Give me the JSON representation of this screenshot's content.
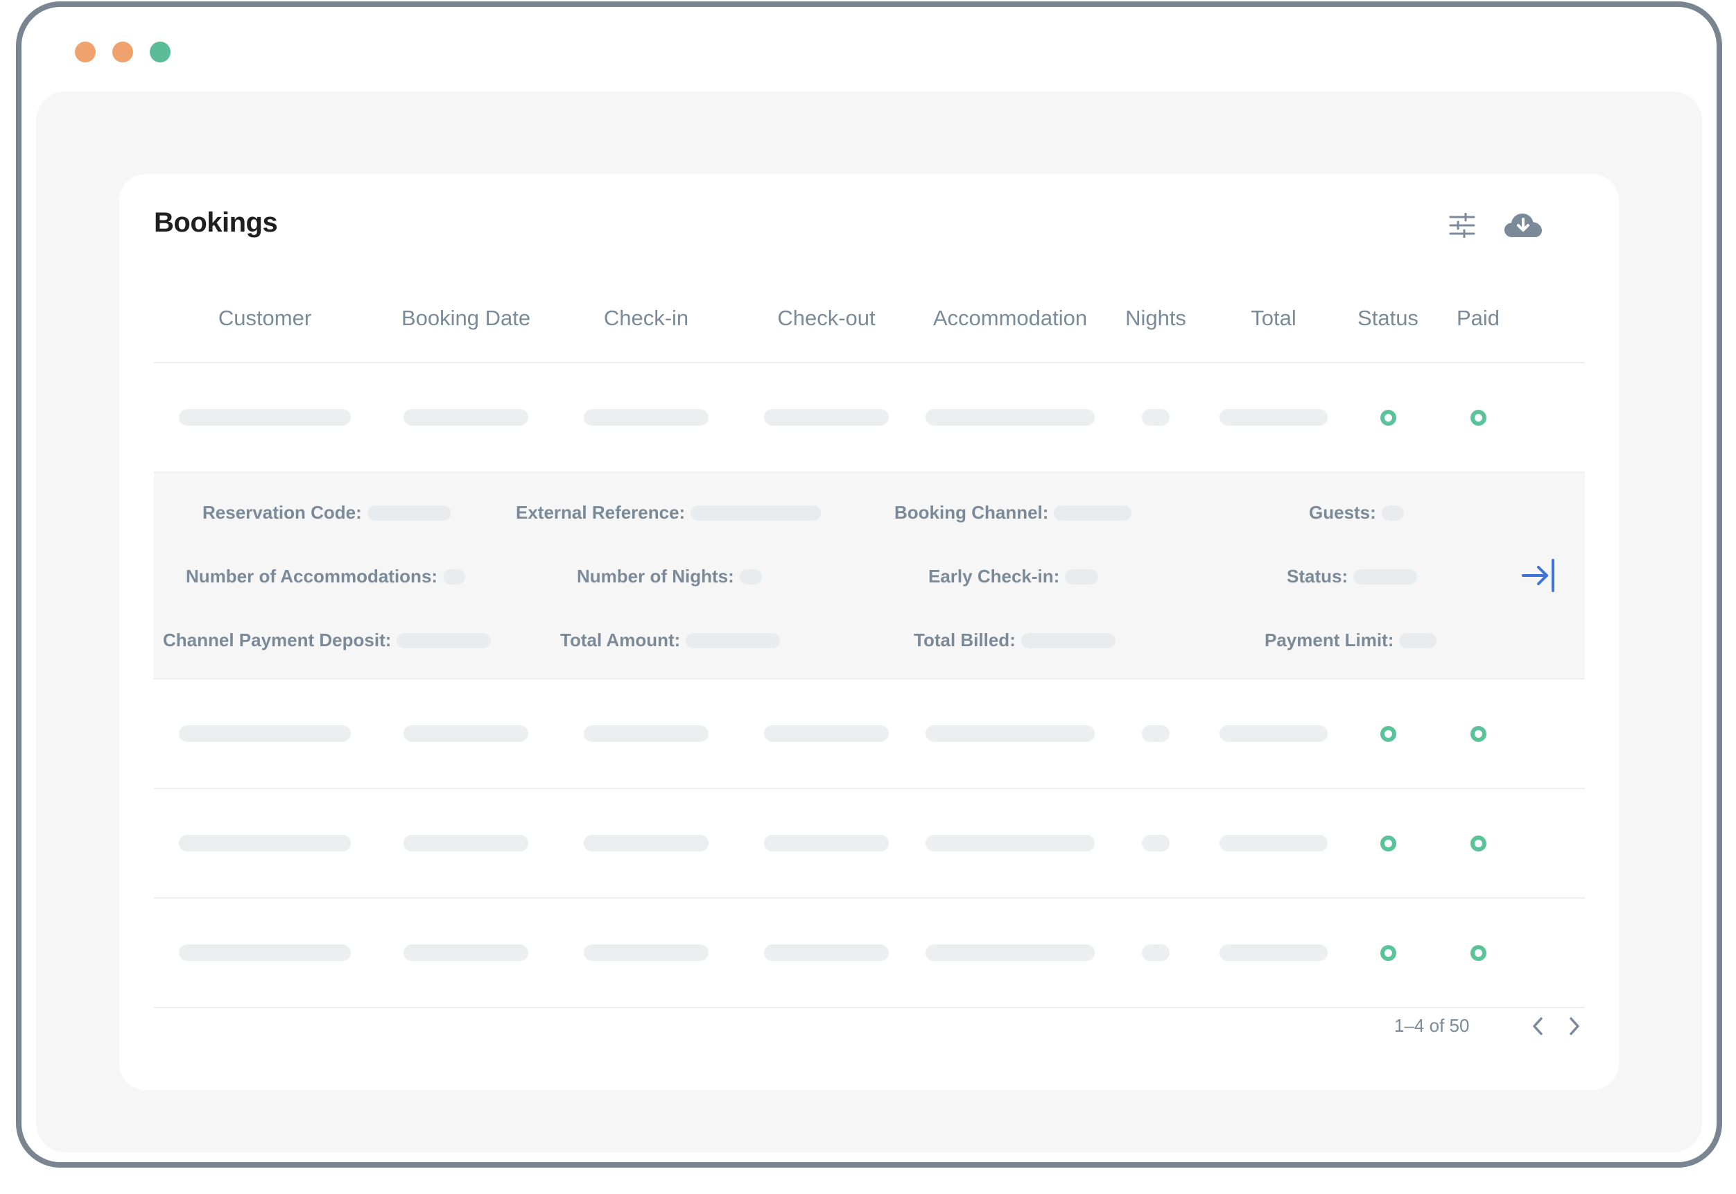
{
  "window": {
    "controls": [
      "close",
      "minimize",
      "maximize"
    ],
    "colors": {
      "close": "#f0a26e",
      "minimize": "#f0a26e",
      "maximize": "#5bbd97"
    }
  },
  "card": {
    "title": "Bookings",
    "toolbar": {
      "filter_icon": "sliders-icon",
      "download_icon": "cloud-download-icon"
    }
  },
  "table": {
    "columns": [
      "Customer",
      "Booking Date",
      "Check-in",
      "Check-out",
      "Accommodation",
      "Nights",
      "Total",
      "Status",
      "Paid"
    ],
    "rows_count_visible": 4,
    "status_color": "#5bc39a"
  },
  "details": {
    "reservation_code": "Reservation Code:",
    "external_reference": "External Reference:",
    "booking_channel": "Booking Channel:",
    "guests": "Guests:",
    "number_of_accommodations": "Number of Accommodations:",
    "number_of_nights": "Number of Nights:",
    "early_check_in": "Early Check-in:",
    "status": "Status:",
    "channel_payment_deposit": "Channel Payment Deposit:",
    "total_amount": "Total Amount:",
    "total_billed": "Total Billed:",
    "payment_limit": "Payment Limit:",
    "expand_icon": "arrow-right-to-bar-icon",
    "accent": "#3f73d8"
  },
  "pagination": {
    "range": "1–4 of 50",
    "prev_icon": "chevron-left-icon",
    "next_icon": "chevron-right-icon"
  }
}
